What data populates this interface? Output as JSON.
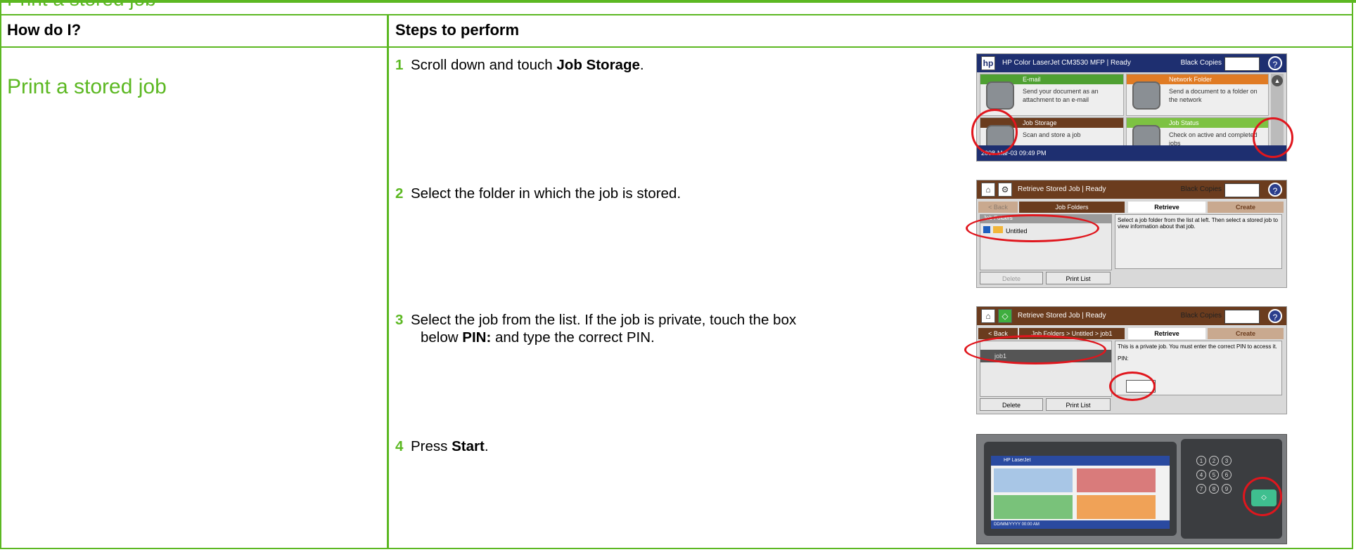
{
  "top_strip_title": "Print a stored job",
  "table": {
    "header_left": "How do I?",
    "header_right": "Steps to perform",
    "task_title": "Print a stored job"
  },
  "steps": [
    {
      "num": "1",
      "pre": "Scroll down and touch ",
      "bold": "Job Storage",
      "post": "."
    },
    {
      "num": "2",
      "pre": "Select the folder in which the job is stored.",
      "bold": "",
      "post": ""
    },
    {
      "num": "3",
      "pre": "Select the job from the list. If the job is private, touch the box",
      "line2_pre": "below ",
      "bold": "PIN:",
      "post": " and type the correct PIN."
    },
    {
      "num": "4",
      "pre": "Press ",
      "bold": "Start",
      "post": "."
    }
  ],
  "screens": {
    "s1": {
      "title": "HP Color LaserJet CM3530 MFP | Ready",
      "copies": "Black Copies",
      "tiles": [
        {
          "name": "E-mail",
          "desc": "Send your document as an attachment to an e-mail"
        },
        {
          "name": "Network Folder",
          "desc": "Send a document to a folder on the network"
        },
        {
          "name": "Job Storage",
          "desc": "Scan and store a job"
        },
        {
          "name": "Job Status",
          "desc": "Check on active and completed jobs"
        }
      ],
      "status": "2008-Mar-03 09:49 PM"
    },
    "s2": {
      "title": "Retrieve Stored Job | Ready",
      "copies": "Black Copies",
      "tab_back": "< Back",
      "tab_folders": "Job Folders",
      "tab_retrieve": "Retrieve",
      "tab_create": "Create",
      "list_header": "Job Folders",
      "folder": "Untitled",
      "info": "Select a job folder from the list at left. Then select a stored job to view information about that job.",
      "btn_delete": "Delete",
      "btn_print": "Print List"
    },
    "s3": {
      "title": "Retrieve Stored Job | Ready",
      "copies": "Black Copies",
      "tab_back": "< Back",
      "path": "Job Folders > Untitled > job1",
      "tab_retrieve": "Retrieve",
      "tab_create": "Create",
      "job": "job1",
      "info": "This is a private job. You must enter the correct PIN to access it.",
      "pin_label": "PIN:",
      "btn_delete": "Delete",
      "btn_print": "Print List"
    },
    "s4": {
      "title": "HP LaserJet",
      "status": "DD/MM/YYYY 00:00 AM",
      "keys": [
        "1",
        "2",
        "3",
        "4",
        "5",
        "6",
        "7",
        "8",
        "9"
      ]
    }
  },
  "colors": {
    "accent_green": "#5cb822",
    "annotation_red": "#e0161d",
    "hp_blue": "#1e2f70",
    "brown": "#6b3c1e"
  }
}
